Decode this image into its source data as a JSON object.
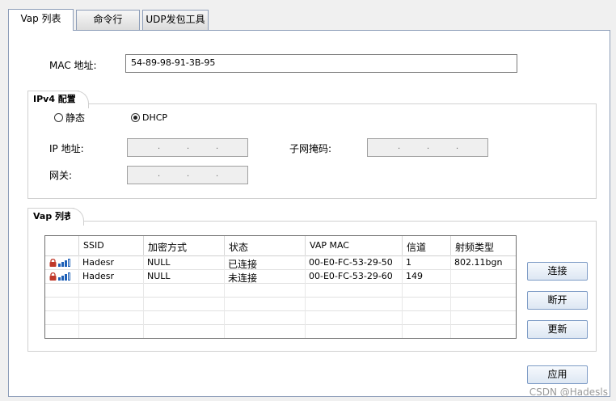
{
  "tabs": [
    {
      "label": "Vap 列表",
      "active": true
    },
    {
      "label": "命令行",
      "active": false
    },
    {
      "label": "UDP发包工具",
      "active": false
    }
  ],
  "mac": {
    "label": "MAC 地址:",
    "value": "54-89-98-91-3B-95"
  },
  "ipv4": {
    "title": "IPv4 配置",
    "static_label": "静态",
    "dhcp_label": "DHCP",
    "selected": "DHCP",
    "ip_label": "IP 地址:",
    "mask_label": "子网掩码:",
    "gateway_label": "网关:"
  },
  "vap": {
    "title": "Vap 列表",
    "columns": [
      "SSID",
      "加密方式",
      "状态",
      "VAP MAC",
      "信道",
      "射频类型"
    ],
    "rows": [
      {
        "ssid": "Hadesr",
        "encryption": "NULL",
        "status": "已连接",
        "mac": "00-E0-FC-53-29-50",
        "channel": "1",
        "radio": "802.11bgn",
        "signal_bars": 3
      },
      {
        "ssid": "Hadesr",
        "encryption": "NULL",
        "status": "未连接",
        "mac": "00-E0-FC-53-29-60",
        "channel": "149",
        "radio": "",
        "signal_bars": 3
      }
    ]
  },
  "buttons": {
    "connect": "连接",
    "disconnect": "断开",
    "refresh": "更新",
    "apply": "应用"
  },
  "icons": {
    "lock": "lock-icon",
    "signal": "signal-icon"
  },
  "colors": {
    "border": "#8c9db8",
    "signal": "#1d5fb7",
    "lock": "#c0392b"
  },
  "watermark": "CSDN @Hadesls"
}
